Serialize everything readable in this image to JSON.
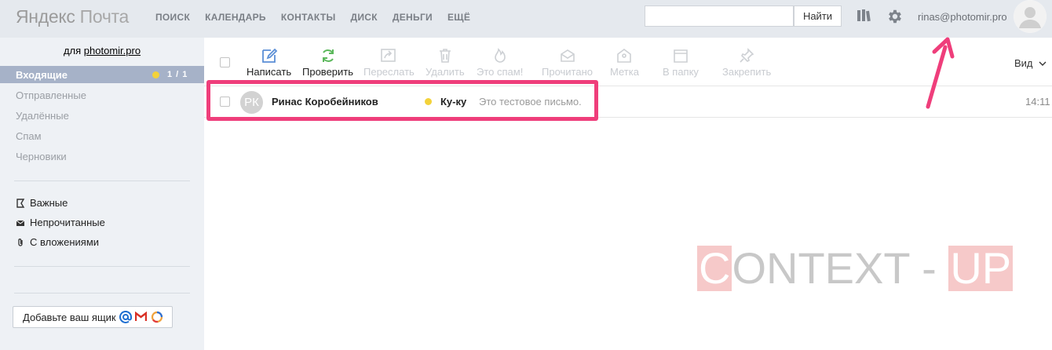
{
  "header": {
    "logo_brand": "Яндекс",
    "logo_product": "Почта",
    "nav": [
      "ПОИСК",
      "КАЛЕНДАРЬ",
      "КОНТАКТЫ",
      "ДИСК",
      "ДЕНЬГИ",
      "ЕЩЁ"
    ],
    "search_value": "",
    "search_button": "Найти",
    "user_email": "rinas@photomir.pro",
    "icons": [
      "books-icon",
      "gear-icon",
      "avatar"
    ]
  },
  "sidebar": {
    "for_prefix": "для",
    "domain": "photomir.pro",
    "inbox_label": "Входящие",
    "inbox_count": "1 / 1",
    "folders": [
      "Отправленные",
      "Удалённые",
      "Спам",
      "Черновики"
    ],
    "filters": [
      "Важные",
      "Непрочитанные",
      "С вложениями"
    ],
    "add_mailbox": "Добавьте ваш ящик"
  },
  "toolbar": {
    "buttons": [
      {
        "label": "Написать",
        "icon": "compose-icon",
        "enabled": true
      },
      {
        "label": "Проверить",
        "icon": "refresh-icon",
        "enabled": true
      },
      {
        "label": "Переслать",
        "icon": "forward-icon",
        "enabled": false
      },
      {
        "label": "Удалить",
        "icon": "trash-icon",
        "enabled": false
      },
      {
        "label": "Это спам!",
        "icon": "spam-icon",
        "enabled": false
      },
      {
        "label": "Прочитано",
        "icon": "read-icon",
        "enabled": false
      },
      {
        "label": "Метка",
        "icon": "label-icon",
        "enabled": false
      },
      {
        "label": "В папку",
        "icon": "folder-icon",
        "enabled": false
      },
      {
        "label": "Закрепить",
        "icon": "pin-icon",
        "enabled": false
      }
    ],
    "view_label": "Вид"
  },
  "messages": [
    {
      "avatar_initials": "РК",
      "from": "Ринас Коробейников",
      "subject": "Ку-ку",
      "snippet": "Это тестовое письмо.",
      "time": "14:11",
      "unread": true
    }
  ],
  "watermark": {
    "c": "C",
    "ontext": "ONTEXT - ",
    "up": "UP"
  },
  "colors": {
    "header_bg": "#e5e9ee",
    "sidebar_bg": "#eef1f5",
    "inbox_active": "#a6b2c8",
    "unread_dot": "#f3d23a",
    "highlight": "#ef3e7b",
    "refresh_green": "#5cb85c"
  }
}
